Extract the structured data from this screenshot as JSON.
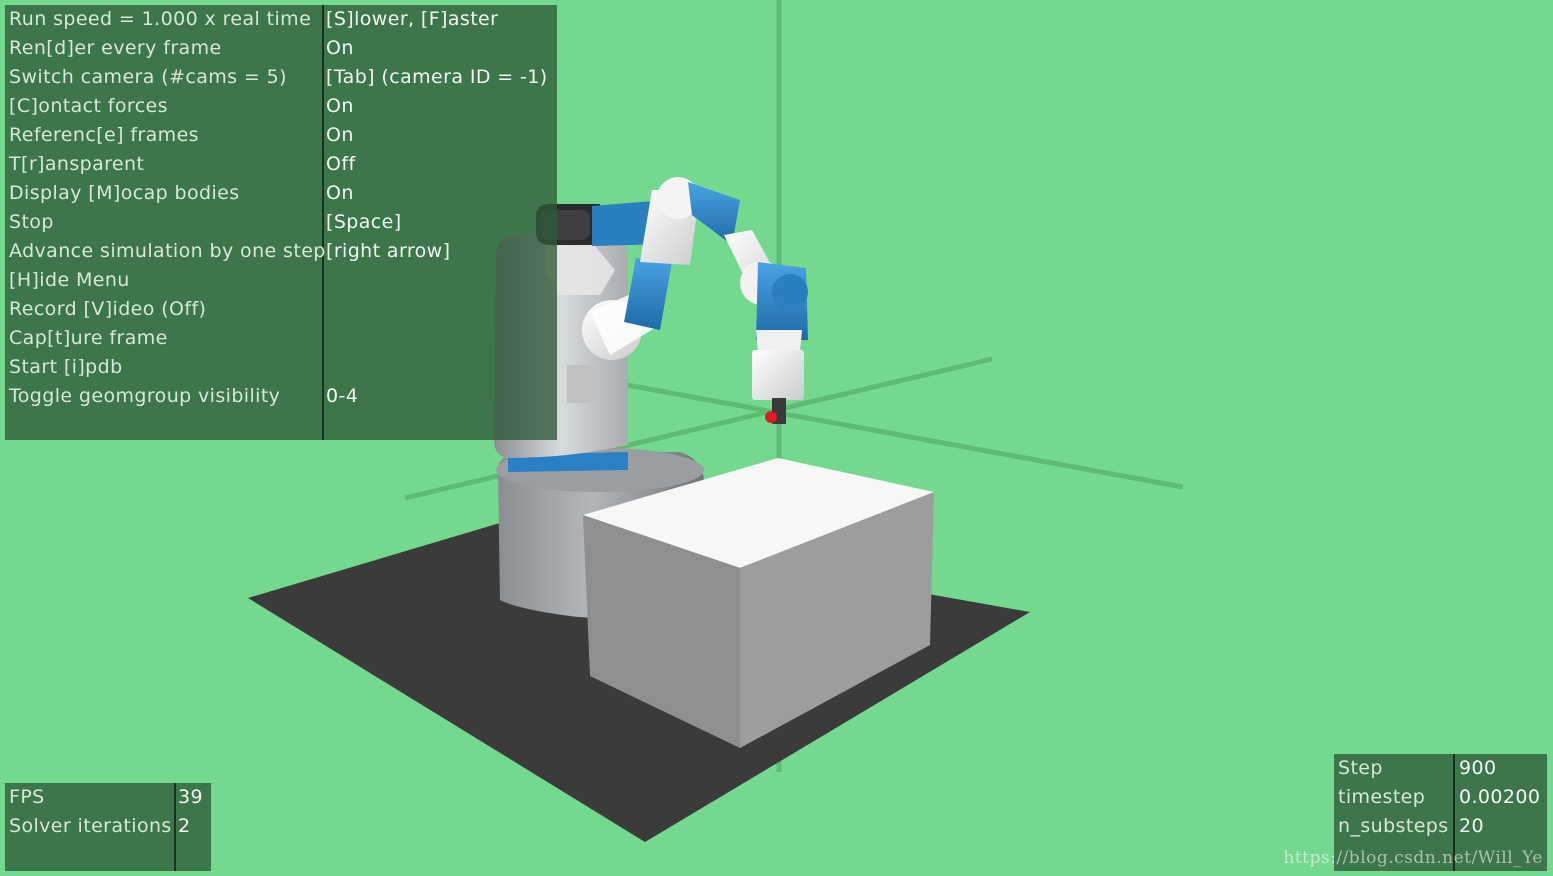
{
  "menu": {
    "rows": [
      {
        "label": "Run speed = 1.000 x real time",
        "value": "[S]lower, [F]aster"
      },
      {
        "label": "Ren[d]er every frame",
        "value": "On"
      },
      {
        "label": "Switch camera (#cams = 5)",
        "value": "[Tab] (camera ID = -1)"
      },
      {
        "label": "[C]ontact forces",
        "value": "On"
      },
      {
        "label": "Referenc[e] frames",
        "value": "On"
      },
      {
        "label": "T[r]ansparent",
        "value": "Off"
      },
      {
        "label": "Display [M]ocap bodies",
        "value": "On"
      },
      {
        "label": "Stop",
        "value": "[Space]"
      },
      {
        "label": "Advance simulation by one step",
        "value": "[right arrow]"
      },
      {
        "label": "[H]ide Menu",
        "value": ""
      },
      {
        "label": "Record [V]ideo (Off)",
        "value": ""
      },
      {
        "label": "Cap[t]ure frame",
        "value": ""
      },
      {
        "label": "Start [i]pdb",
        "value": ""
      },
      {
        "label": "Toggle geomgroup visibility",
        "value": "0-4"
      }
    ]
  },
  "performance": {
    "fps_label": "FPS",
    "fps_value": "39",
    "solver_label": "Solver iterations",
    "solver_value": "2"
  },
  "simulation": {
    "step_label": "Step",
    "step_value": "900",
    "timestep_label": "timestep",
    "timestep_value": "0.00200",
    "substeps_label": "n_substeps",
    "substeps_value": "20"
  },
  "watermark": "https://blog.csdn.net/Will_Ye",
  "colors": {
    "background": "#74d98f",
    "panel": "#2d5a37",
    "floor": "#3a3a3a",
    "table_top": "#f7f7f7",
    "robot_blue": "#2a7fc1",
    "target_marker": "#d42020"
  }
}
